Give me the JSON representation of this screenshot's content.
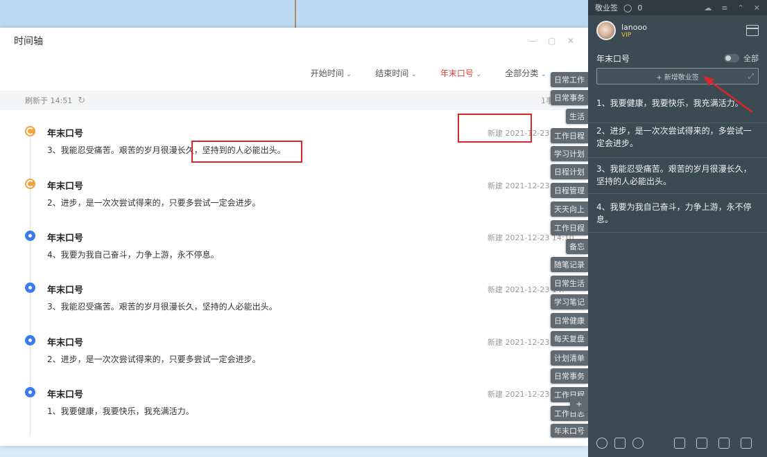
{
  "main_window": {
    "title": "时间轴",
    "toolbar": {
      "start_time": "开始时间",
      "end_time": "结束时间",
      "active_filter": "年末口号",
      "all_categories": "全部分类"
    },
    "refresh_label": "刷新于 14:51",
    "refresh_right": "1事",
    "entries": [
      {
        "title": "年末口号",
        "text": "3、我能忍受痛苦。艰苦的岁月很漫长久，坚持到的人必能出头。",
        "time": "新建 2021-12-23 14:1",
        "dot": "orange"
      },
      {
        "title": "年末口号",
        "text": "2、进步，是一次次尝试得来的，只要多尝试一定会进步。",
        "time": "新建 2021-12-23 14:1",
        "dot": "orange"
      },
      {
        "title": "年末口号",
        "text": "4、我要为我自己奋斗，力争上游，永不停息。",
        "time": "新建 2021-12-23 14:10",
        "dot": "blue"
      },
      {
        "title": "年末口号",
        "text": "3、我能忍受痛苦。艰苦的岁月很漫长久，坚持的人必能出头。",
        "time": "新建 2021-12-23 14:",
        "dot": "blue"
      },
      {
        "title": "年末口号",
        "text": "2、进步，是一次次尝试得来的，只要多尝试一定会进步。",
        "time": "新建 2021-12-23 14:",
        "dot": "blue"
      },
      {
        "title": "年末口号",
        "text": "1、我要健康，我要快乐，我充满活力。",
        "time": "新建 2021-12-23 14:",
        "dot": "blue"
      }
    ]
  },
  "side_tabs": [
    "日常工作",
    "日常事务",
    "生活",
    "工作日程",
    "学习计划",
    "日程计划",
    "日程管理",
    "天天向上",
    "工作日程",
    "备忘",
    "随笔记录",
    "日常生活",
    "学习笔记",
    "日常健康",
    "每天复盘",
    "计划清单",
    "日常事务",
    "工作日程",
    "工作日志",
    "年末口号",
    "+"
  ],
  "notes_panel": {
    "app_label": "敬业签",
    "message_count": "0",
    "username": "lanooo",
    "vip_label": "VIP",
    "heading": "年末口号",
    "filter": "全部",
    "input_placeholder": "+ 新增敬业签",
    "notes": [
      "1、我要健康，我要快乐，我充满活力。",
      "2、进步，是一次次尝试得来的，多尝试一定会进步。",
      "3、我能忍受痛苦。艰苦的岁月很漫长久，坚持的人必能出头。",
      "4、我要为我自己奋斗，力争上游，永不停息。"
    ]
  },
  "colors": {
    "accent_red": "#d9262b",
    "panel_bg": "#3c4a53",
    "dot_blue": "#3a7cf0",
    "dot_orange": "#f1a340"
  }
}
